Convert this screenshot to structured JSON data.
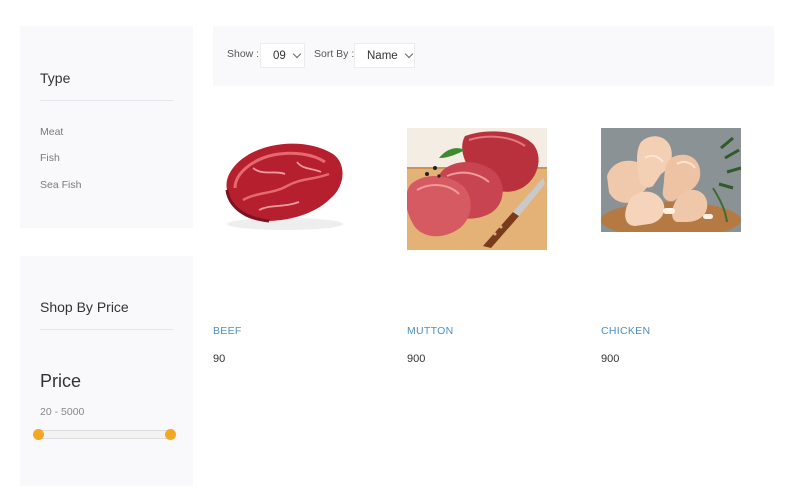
{
  "sidebar": {
    "type_section": {
      "title": "Type",
      "items": [
        "Meat",
        "Fish",
        "Sea Fish"
      ]
    },
    "price_section": {
      "title": "Shop By Price",
      "heading": "Price",
      "range_text": "20 - 5000",
      "range_min": 20,
      "range_max": 5000
    }
  },
  "toolbar": {
    "show_label": "Show :",
    "show_value": "09",
    "sort_label": "Sort By :",
    "sort_value": "Name"
  },
  "products": [
    {
      "name": "BEEF",
      "price": "90"
    },
    {
      "name": "MUTTON",
      "price": "900"
    },
    {
      "name": "CHICKEN",
      "price": "900"
    }
  ],
  "colors": {
    "accent": "#f5a623",
    "link": "#4a90c8",
    "panel_bg": "#f9f9fb"
  }
}
